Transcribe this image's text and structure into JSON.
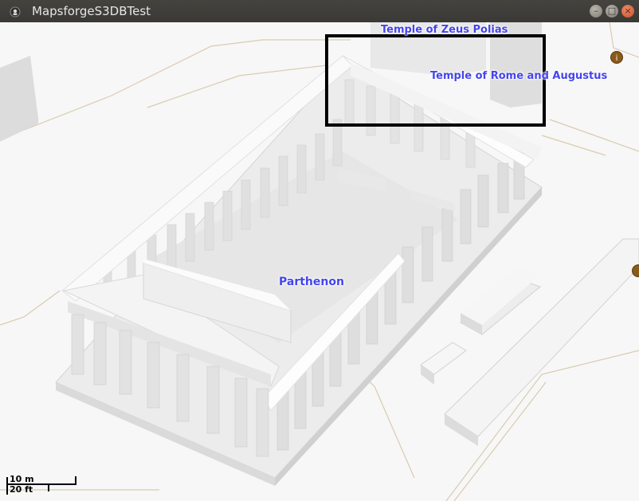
{
  "window": {
    "title": "MapsforgeS3DBTest"
  },
  "map": {
    "labels": {
      "zeus": "Temple of Zeus Polias",
      "rome": "Temple of Rome and Augustus",
      "parthenon": "Parthenon"
    },
    "poi_icons": [
      "info-poi-icon",
      "info-poi-icon"
    ],
    "label_color": "#4444ee",
    "scalebar": {
      "metric": "10 m",
      "imperial": "20 ft"
    },
    "highlight_box_color": "#000000"
  }
}
